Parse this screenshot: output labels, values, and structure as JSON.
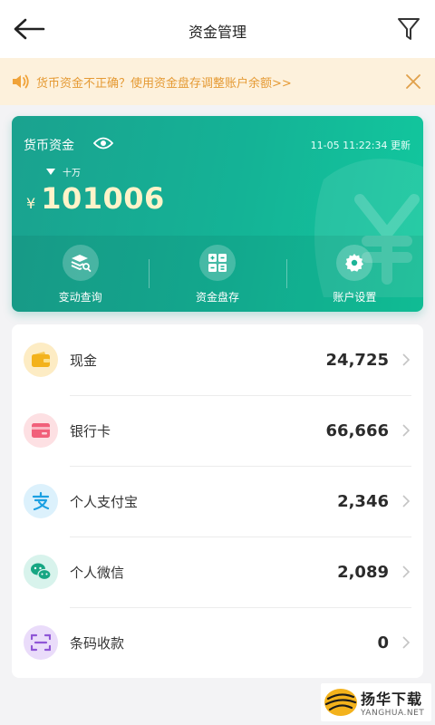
{
  "header": {
    "title": "资金管理",
    "back_icon": "arrow-left-icon",
    "filter_icon": "filter-icon"
  },
  "notice": {
    "text": "货币资金不正确？使用资金盘存调整账户余额>>",
    "icon": "speaker-icon",
    "close_icon": "close-icon",
    "color": "#e59a34",
    "background": "#fdf1dc"
  },
  "card": {
    "title": "货币资金",
    "updated": "11-05 11:22:34 更新",
    "unit": "十万",
    "currency": "¥",
    "amount": "101006",
    "gradient": [
      "#1aa28f",
      "#12c89e"
    ],
    "actions": [
      {
        "label": "变动查询",
        "icon": "stack-search-icon"
      },
      {
        "label": "资金盘存",
        "icon": "calculator-icon"
      },
      {
        "label": "账户设置",
        "icon": "gear-icon"
      }
    ]
  },
  "accounts": [
    {
      "label": "现金",
      "value": "24,725",
      "icon": "wallet-icon",
      "bg": "#fdecc4",
      "fg": "#f3b21c"
    },
    {
      "label": "银行卡",
      "value": "66,666",
      "icon": "bank-card-icon",
      "bg": "#fde0e3",
      "fg": "#f1607a"
    },
    {
      "label": "个人支付宝",
      "value": "2,346",
      "icon": "alipay-icon",
      "bg": "#dcf1fc",
      "fg": "#1ba0e2"
    },
    {
      "label": "个人微信",
      "value": "2,089",
      "icon": "wechat-icon",
      "bg": "#d8f3ec",
      "fg": "#17a683"
    },
    {
      "label": "条码收款",
      "value": "0",
      "icon": "barcode-scan-icon",
      "bg": "#eadcfa",
      "fg": "#8f56d6"
    }
  ],
  "watermark": {
    "cn": "扬华下载",
    "en": "YANGHUA.NET"
  }
}
